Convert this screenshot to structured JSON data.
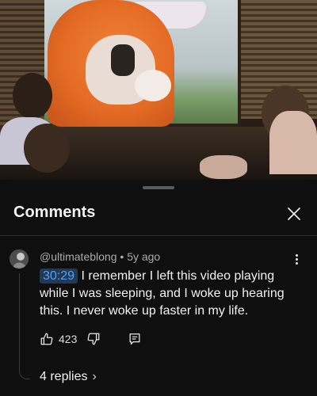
{
  "panel": {
    "title": "Comments"
  },
  "comment": {
    "author": "@ultimateblong",
    "separator": "•",
    "age": "5y ago",
    "timestamp": "30:29",
    "text": "I remember I left this video playing while I was sleeping, and I woke up hearing this. I never woke up faster in my life.",
    "likes": "423",
    "replies_label": "4 replies"
  },
  "icons": {
    "close": "close-icon",
    "more": "more-vert-icon",
    "like": "thumbs-up-icon",
    "dislike": "thumbs-down-icon",
    "reply": "reply-icon",
    "chevron": "chevron-right-icon"
  },
  "colors": {
    "background": "#0f0f0f",
    "timestamp_text": "#4aa3ff",
    "timestamp_bg": "#263850",
    "muted_text": "#aaaaaa"
  }
}
